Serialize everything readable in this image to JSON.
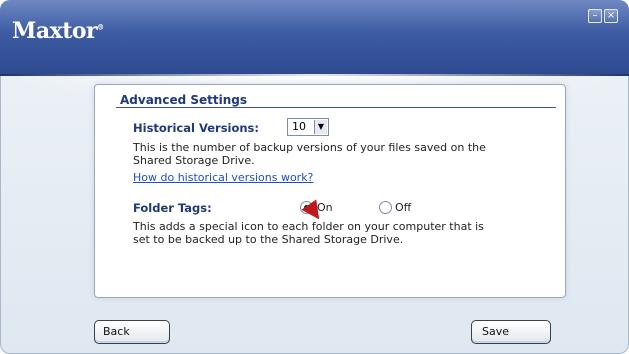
{
  "window": {
    "brand": "Maxtor",
    "brand_mark": "®",
    "controls": [
      "minimize-icon",
      "close-icon"
    ]
  },
  "advanced_settings": {
    "title": "Advanced Settings",
    "historical_versions": {
      "label": "Historical Versions:",
      "selected": "10",
      "description_line1": "This is the number of backup versions of your files saved on the",
      "description_line2": "Shared Storage Drive.",
      "help_link": "How do historical versions work?"
    },
    "folder_tags": {
      "label": "Folder Tags:",
      "option_on": "On",
      "option_off": "Off",
      "selected": "On",
      "description_line1": "This adds a special icon to each folder on your computer that is",
      "description_line2": "set to be backed up to the Shared Storage Drive."
    }
  },
  "footer": {
    "back_label": "Back",
    "save_label": "Save"
  },
  "colors": {
    "titlebar": "#3d5ba2",
    "accent_text": "#1e3a7a",
    "link": "#1f4fc2"
  }
}
